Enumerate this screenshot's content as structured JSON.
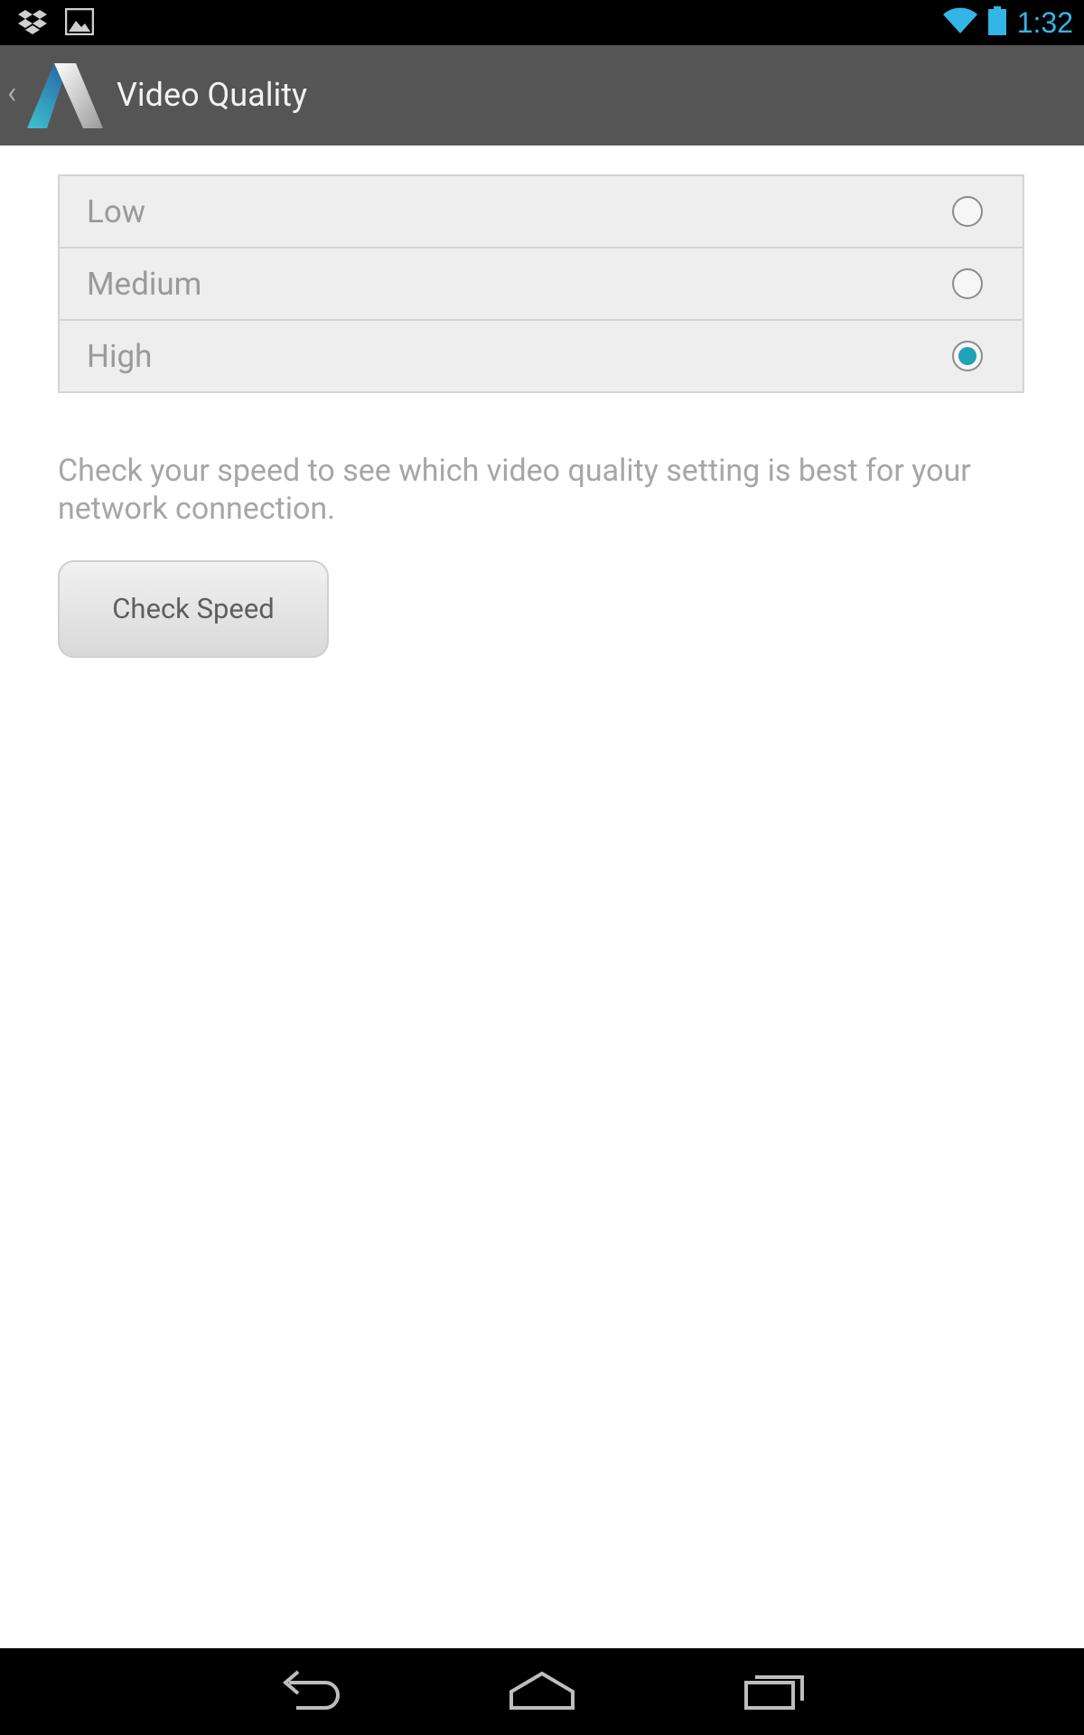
{
  "status_bar": {
    "time": "1:32",
    "accent_color": "#33b5e5",
    "left_icons": [
      "dropbox-icon",
      "image-icon"
    ],
    "right_icons": [
      "wifi-icon",
      "battery-icon"
    ]
  },
  "action_bar": {
    "title": "Video Quality",
    "back_icon": "chevron-left-icon",
    "logo": "app-logo"
  },
  "quality_options": [
    {
      "label": "Low",
      "selected": false
    },
    {
      "label": "Medium",
      "selected": false
    },
    {
      "label": "High",
      "selected": true
    }
  ],
  "description": "Check your speed to see which video quality setting is best for your network connection.",
  "check_speed_button": "Check Speed",
  "colors": {
    "radio_selected": "#1fa3b5",
    "action_bar_bg": "#555555"
  },
  "nav_bar": {
    "icons": [
      "back-icon",
      "home-icon",
      "recents-icon"
    ]
  }
}
